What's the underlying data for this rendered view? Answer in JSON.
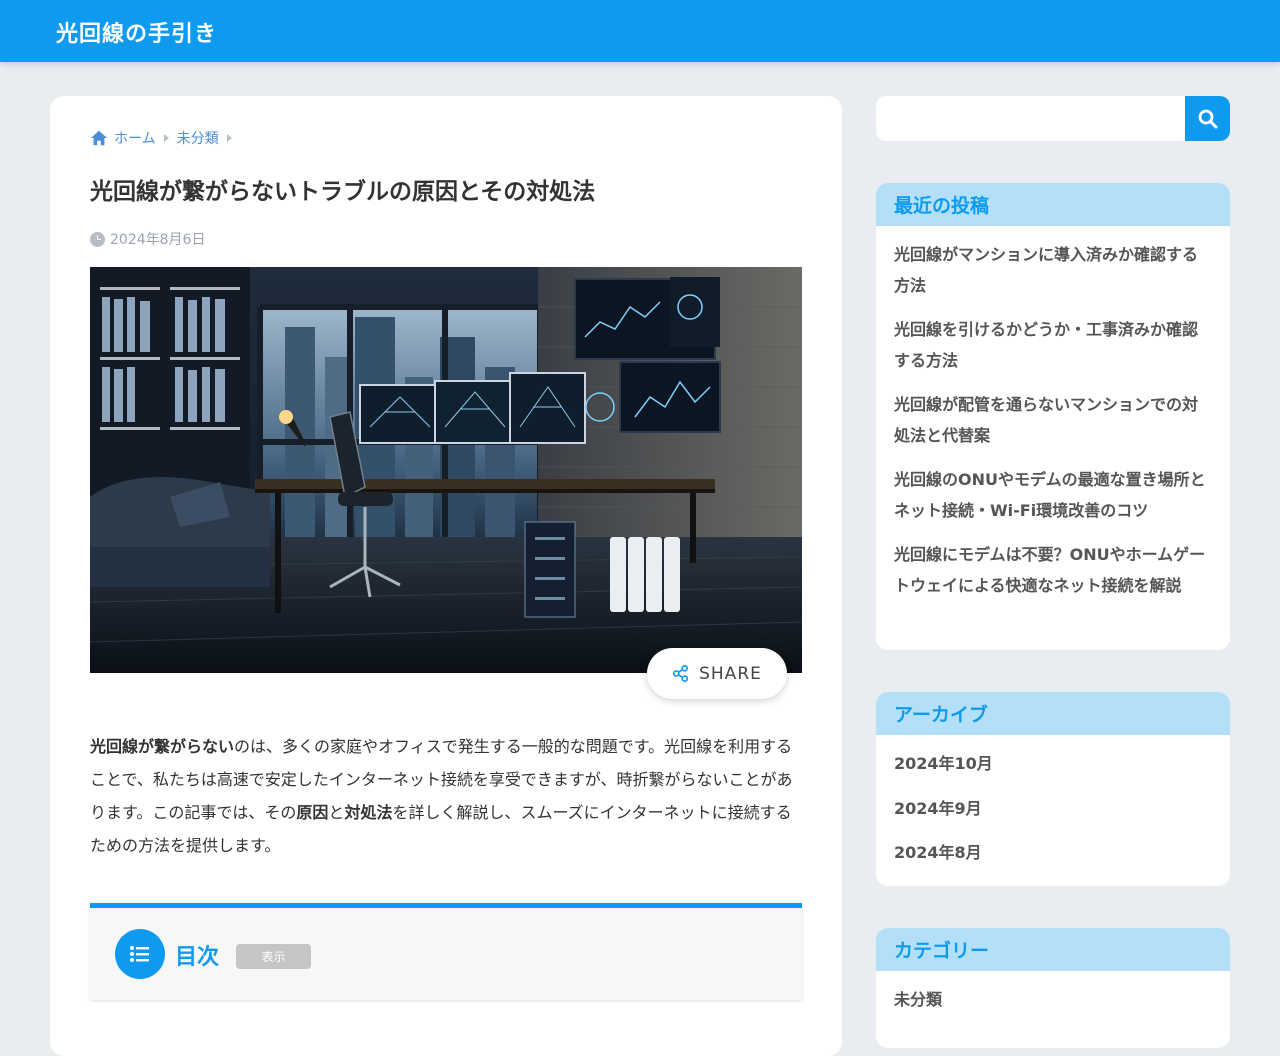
{
  "site": {
    "title": "光回線の手引き"
  },
  "breadcrumb": {
    "home": "ホーム",
    "category": "未分類"
  },
  "post": {
    "title": "光回線が繋がらないトラブルの原因とその対処法",
    "date": "2024年8月6日",
    "share_label": "SHARE",
    "intro": {
      "p1_bold": "光回線が繋がらない",
      "p1_text": "のは、多くの家庭やオフィスで発生する一般的な問題です。光回線を利用することで、私たちは高速で安定したインターネット接続を享受できますが、時折繋がらないことがあります。この記事では、その",
      "p1_bold2": "原因",
      "p1_and": "と",
      "p1_bold3": "対処法",
      "p1_text2": "を詳しく解説し、スムーズにインターネットに接続するための方法を提供します。"
    }
  },
  "toc": {
    "title": "目次",
    "toggle": "表示"
  },
  "search": {
    "placeholder": ""
  },
  "sidebar": {
    "recent": {
      "title": "最近の投稿",
      "items": [
        "光回線がマンションに導入済みか確認する方法",
        "光回線を引けるかどうか・工事済みか確認する方法",
        "光回線が配管を通らないマンションでの対処法と代替案",
        "光回線のONUやモデムの最適な置き場所とネット接続・Wi-Fi環境改善のコツ",
        "光回線にモデムは不要？ONUやホームゲートウェイによる快適なネット接続を解説"
      ]
    },
    "archive": {
      "title": "アーカイブ",
      "items": [
        "2024年10月",
        "2024年9月",
        "2024年8月"
      ]
    },
    "category": {
      "title": "カテゴリー",
      "items": [
        "未分類"
      ]
    }
  },
  "colors": {
    "accent": "#0e9bef",
    "widget_header": "#b3dff8",
    "background": "#e9edf2"
  }
}
